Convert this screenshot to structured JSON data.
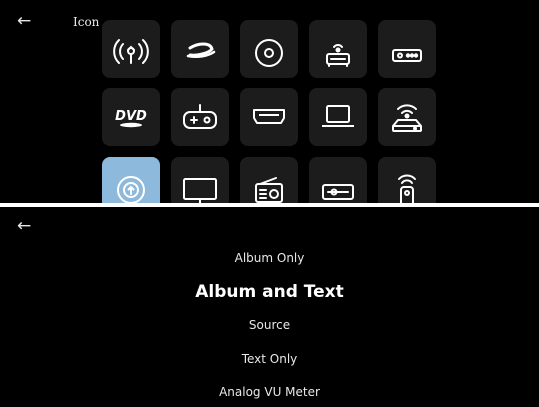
{
  "top_screen": {
    "back_icon": "←",
    "title": "Icon",
    "icons": [
      {
        "name": "antenna-up-icon"
      },
      {
        "name": "bluray-icon"
      },
      {
        "name": "disc-icon"
      },
      {
        "name": "network-device-icon"
      },
      {
        "name": "streamer-box-icon"
      },
      {
        "name": "dvd-icon"
      },
      {
        "name": "gamepad-icon"
      },
      {
        "name": "hdmi-icon"
      },
      {
        "name": "laptop-icon"
      },
      {
        "name": "router-icon"
      },
      {
        "name": "antenna-circle-icon",
        "selected": true
      },
      {
        "name": "monitor-icon"
      },
      {
        "name": "radio-icon"
      },
      {
        "name": "receiver-icon"
      },
      {
        "name": "remote-icon"
      }
    ],
    "dvd_label": "DVD",
    "colors": {
      "background": "#000000",
      "tile": "#1c1c1c",
      "selected_tile": "#8db9dc"
    }
  },
  "bottom_screen": {
    "back_icon": "←",
    "options": [
      {
        "label": "Album Only"
      },
      {
        "label": "Album and Text",
        "active": true
      },
      {
        "label": "Source"
      },
      {
        "label": "Text Only"
      },
      {
        "label": "Analog VU Meter"
      }
    ]
  }
}
